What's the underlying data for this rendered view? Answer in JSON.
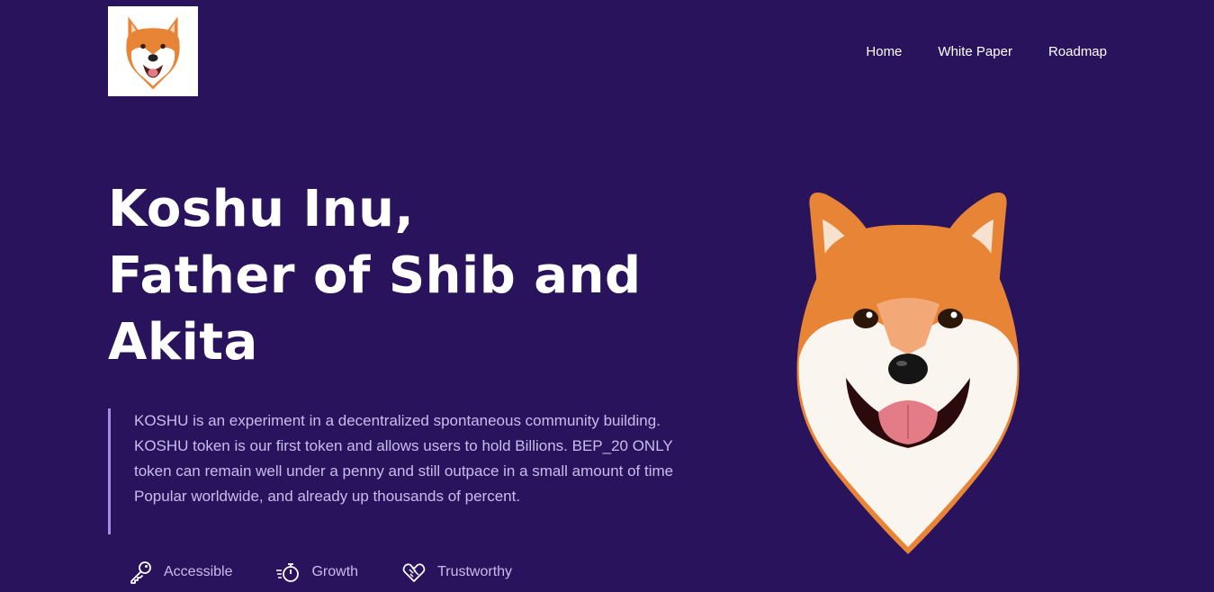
{
  "header": {
    "logo_alt": "Koshu Inu logo",
    "nav": [
      {
        "label": "Home"
      },
      {
        "label": "White Paper"
      },
      {
        "label": "Roadmap"
      }
    ]
  },
  "hero": {
    "title_lines": [
      "Koshu Inu,",
      "Father of Shib and",
      "Akita"
    ],
    "description": "KOSHU is an experiment in a decentralized spontaneous community building. KOSHU token is our first token and allows users to hold Billions. BEP_20 ONLY token can remain well under a penny and still outpace in a small amount of time Popular worldwide, and already up thousands of percent.",
    "features": [
      {
        "label": "Accessible",
        "icon": "key-icon"
      },
      {
        "label": "Growth",
        "icon": "stopwatch-icon"
      },
      {
        "label": "Trustworthy",
        "icon": "handshake-icon"
      }
    ],
    "illustration": "shiba-inu-dog-face"
  },
  "colors": {
    "background": "#29135c",
    "text": "#ffffff",
    "muted_text": "#cbbbed",
    "quote_border": "#a98be0",
    "dog_orange": "#e88436"
  }
}
